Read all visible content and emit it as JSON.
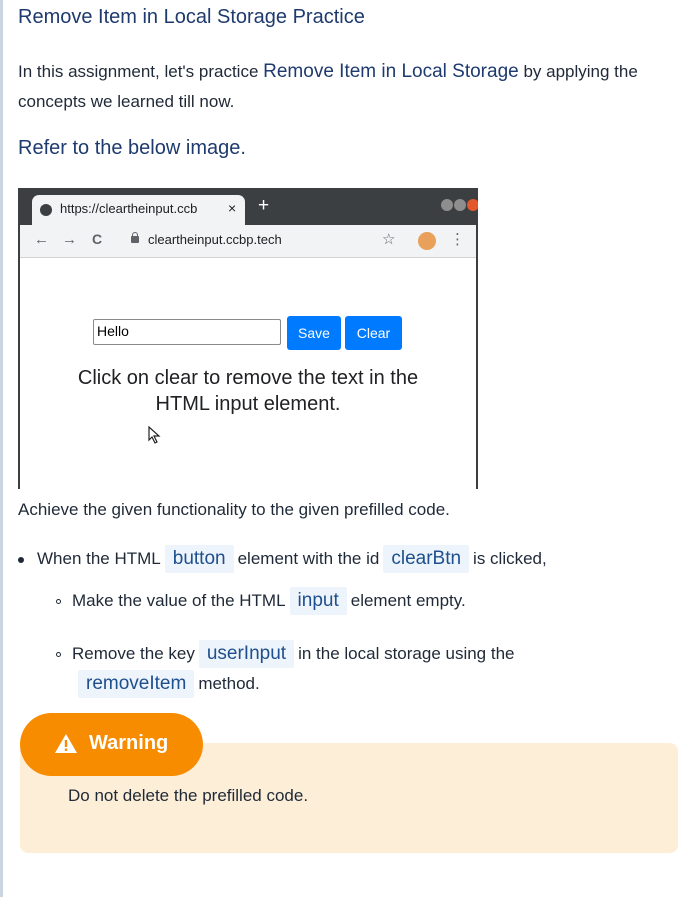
{
  "title": "Remove Item in Local Storage Practice",
  "intro": {
    "before": "In this assignment, let's practice ",
    "highlight": "Remove Item in Local Storage",
    "after": " by applying the concepts we learned till now."
  },
  "refer_heading": "Refer to the below image.",
  "screenshot": {
    "tab_url": "https://cleartheinput.ccb",
    "tab_close": "×",
    "new_tab": "+",
    "nav_back": "←",
    "nav_forward": "→",
    "nav_reload": "C",
    "address": "cleartheinput.ccbp.tech",
    "star": "☆",
    "menu": "⋮",
    "input_value": "Hello",
    "save_label": "Save",
    "clear_label": "Clear",
    "message": "Click on clear to remove the text in the HTML input element.",
    "window_colors": [
      "#8e8e8e",
      "#8e8e8e",
      "#e2572c"
    ]
  },
  "achieve": "Achieve the given functionality to the given prefilled code.",
  "bullets": {
    "main_pre": "When the HTML",
    "main_code1": "button",
    "main_mid": "element with the id",
    "main_code2": "clearBtn",
    "main_post": "is clicked,",
    "sub1_pre": "Make the value of the HTML",
    "sub1_code": "input",
    "sub1_post": "element empty.",
    "sub2_pre": "Remove the key",
    "sub2_code": "userInput",
    "sub2_post": "in the local storage using the",
    "sub2_code2": "removeItem",
    "sub2_post2": "method."
  },
  "warning": {
    "label": "Warning",
    "text": "Do not delete the prefilled code."
  },
  "colors": {
    "heading": "#1e3a6e",
    "code_bg": "#eef4fb",
    "warning_pill": "#f88c00",
    "warning_bg": "#fdeed7",
    "button_blue": "#007bff"
  }
}
